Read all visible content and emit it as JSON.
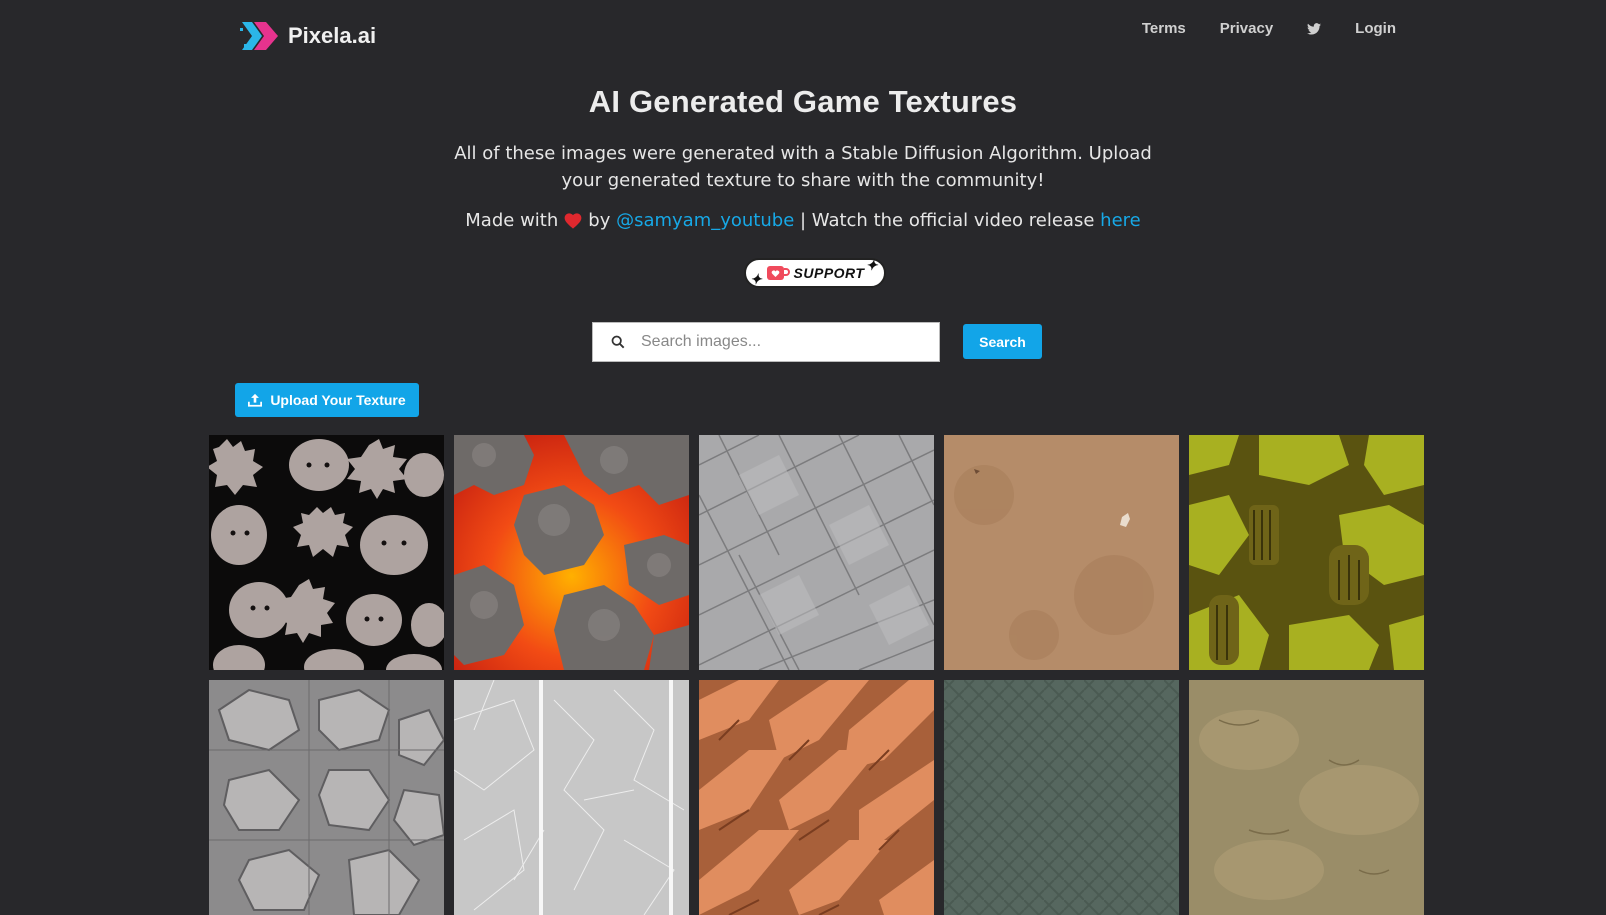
{
  "header": {
    "brand": "Pixela.ai",
    "nav": [
      "Terms",
      "Privacy",
      "Login"
    ]
  },
  "hero": {
    "title": "AI Generated Game Textures",
    "description": "All of these images were generated with a Stable Diffusion Algorithm. Upload your generated texture to share with the community!",
    "made_with": "Made with",
    "by": "by",
    "author": "@samyam_youtube",
    "watch": "| Watch the official video release",
    "here": "here"
  },
  "support": {
    "label": "SUPPORT"
  },
  "search": {
    "placeholder": "Search images...",
    "button": "Search"
  },
  "upload": {
    "label": "Upload Your Texture"
  },
  "colors": {
    "accent": "#12a5e8",
    "background": "#28282b",
    "link": "#17a8e6"
  },
  "textures": [
    "monster-silhouettes",
    "lava-rocks",
    "grey-tiles",
    "sand",
    "mossy-ruins",
    "grey-stones",
    "cracked-marble",
    "red-rock-cliffs",
    "green-herringbone",
    "dusty-ground"
  ]
}
